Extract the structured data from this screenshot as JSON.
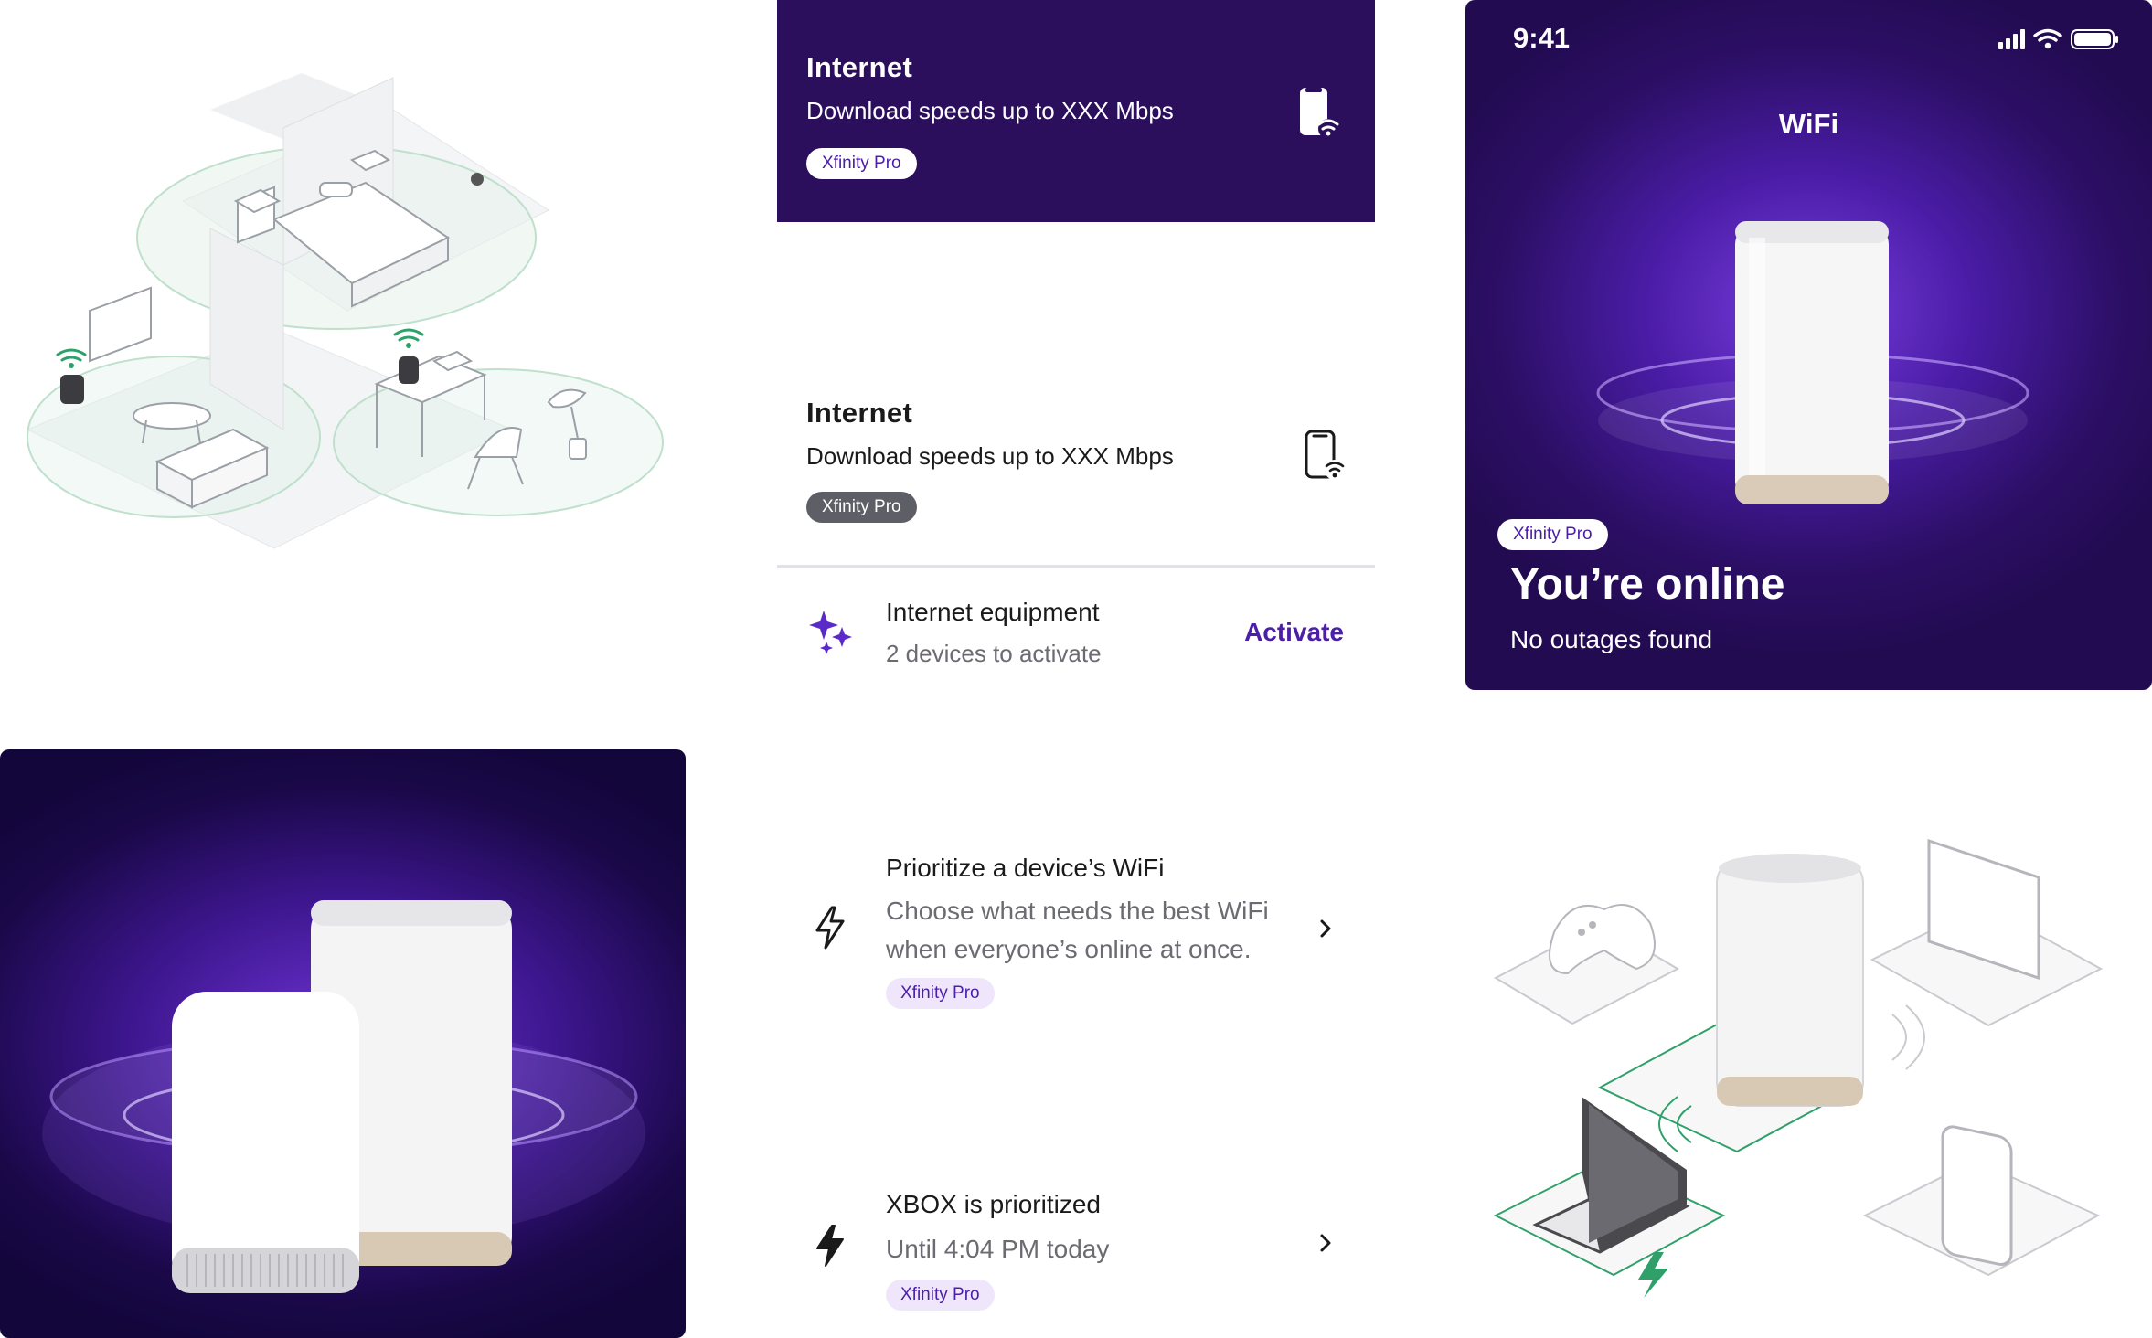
{
  "internet_dark_card": {
    "title": "Internet",
    "subtitle": "Download speeds up to XXX Mbps",
    "badge": "Xfinity Pro",
    "icon": "phone-wifi-icon"
  },
  "internet_light_card": {
    "title": "Internet",
    "subtitle": "Download speeds up to XXX Mbps",
    "badge": "Xfinity Pro",
    "icon": "phone-wifi-icon"
  },
  "equipment": {
    "title": "Internet equipment",
    "subtitle": "2 devices to activate",
    "action": "Activate",
    "icon": "sparkle-icon"
  },
  "wifi_screen": {
    "time": "9:41",
    "heading": "WiFi",
    "badge": "Xfinity Pro",
    "status_title": "You’re online",
    "status_sub": "No outages found"
  },
  "features": [
    {
      "title": "Prioritize a device’s WiFi",
      "description": "Choose what needs the best WiFi when everyone’s online at once.",
      "badge": "Xfinity Pro",
      "icon": "lightning-outline-icon"
    },
    {
      "title": "XBOX is prioritized",
      "description": "Until 4:04 PM today",
      "badge": "Xfinity Pro",
      "icon": "lightning-filled-icon"
    }
  ],
  "colors": {
    "brand_purple": "#2b0f5c",
    "accent_purple": "#4b1fa8",
    "badge_light": "#efe6fb",
    "badge_gray": "#5e5e66",
    "wifi_green": "#2fa06a"
  }
}
